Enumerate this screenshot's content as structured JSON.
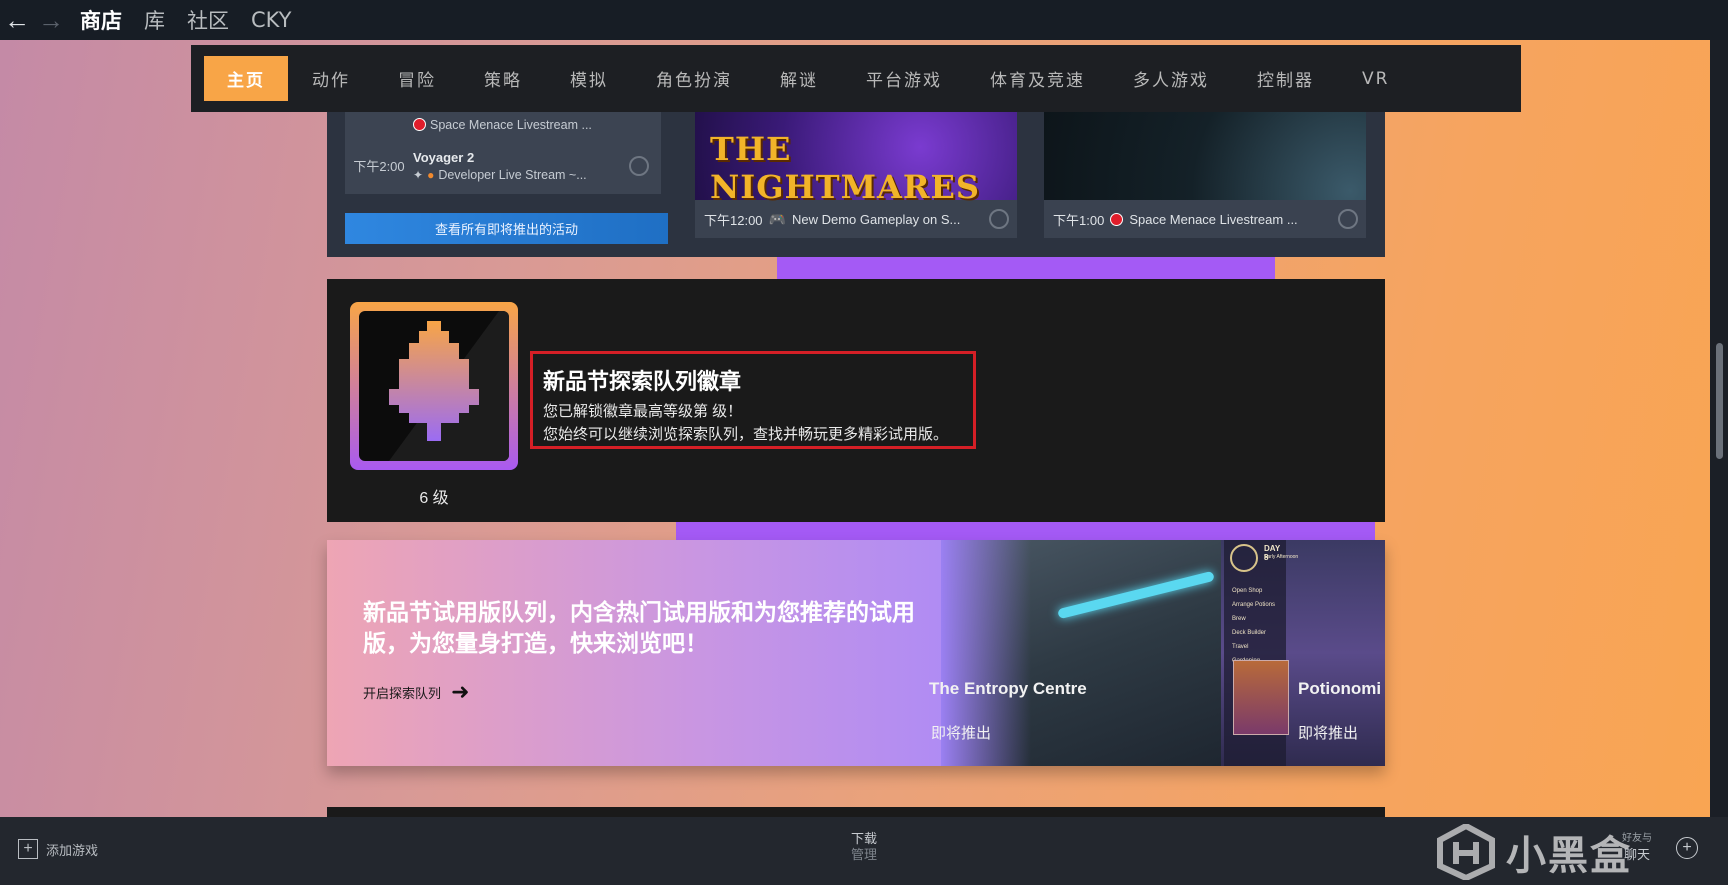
{
  "topbar": {
    "back_icon": "arrow-left-icon",
    "forward_icon": "arrow-right-icon",
    "nav": [
      "商店",
      "库",
      "社区",
      "CKY"
    ]
  },
  "category_nav": [
    "主页",
    "动作",
    "冒险",
    "策略",
    "模拟",
    "角色扮演",
    "解谜",
    "平台游戏",
    "体育及竞速",
    "多人游戏",
    "控制器",
    "VR"
  ],
  "events": {
    "rows": [
      {
        "time": "",
        "title": "",
        "subtitle": "Space Menace Livestream ..."
      },
      {
        "time": "下午2:00",
        "title": "Voyager 2",
        "subtitle": "Developer Live Stream ~..."
      }
    ],
    "see_all_label": "查看所有即将推出的活动",
    "thumbs": [
      {
        "image_text": "THE NIGHTMARES",
        "time": "下午12:00",
        "caption": "New Demo Gameplay on S..."
      },
      {
        "image_text": "",
        "time": "下午1:00",
        "caption": "Space Menace Livestream ..."
      }
    ]
  },
  "badge": {
    "level": "6 级",
    "title": "新品节探索队列徽章",
    "line1": "您已解锁徽章最高等级第 级！",
    "line2": "您始终可以继续浏览探索队列，查找并畅玩更多精彩试用版。"
  },
  "queue": {
    "headline": "新品节试用版队列，内含热门试用版和为您推荐的试用版，为您量身打造，快来浏览吧！",
    "link_label": "开启探索队列",
    "cards": [
      {
        "name": "The Entropy Centre",
        "status": "即将推出"
      },
      {
        "name": "Potionomi",
        "status": "即将推出",
        "overlay_day": "DAY 8",
        "overlay_time": "Early Afternoon",
        "menu": [
          "Open Shop",
          "Arrange Potions",
          "Brew",
          "Deck Builder",
          "Travel",
          "Gardening"
        ]
      }
    ]
  },
  "bottombar": {
    "add_game_label": "添加游戏",
    "downloads_label": "下载",
    "downloads_sub": "管理",
    "chat_line1": "好友与",
    "chat_line2": "聊天",
    "watermark": "小黑盒"
  },
  "colors": {
    "accent_orange": "#f8a547",
    "accent_purple": "#a45af5",
    "highlight_red": "#d51f26",
    "link_blue": "#2f87e0"
  }
}
